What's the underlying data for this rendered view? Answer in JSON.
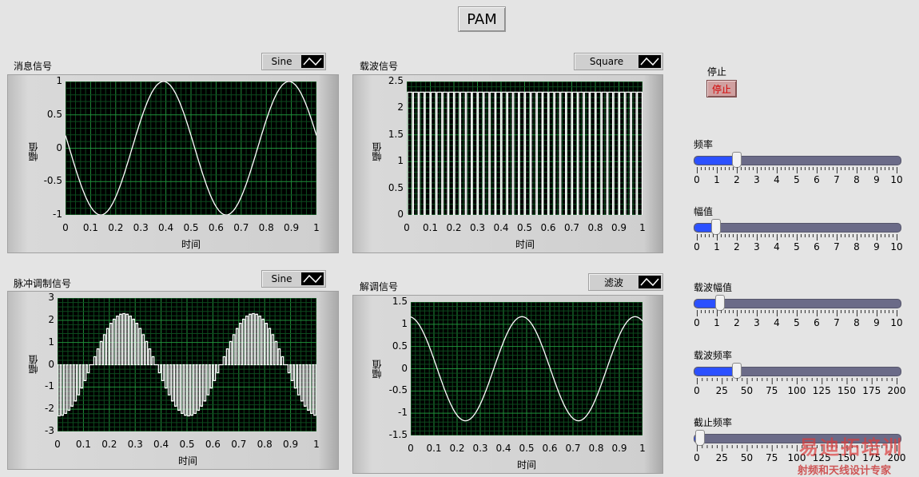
{
  "window": {
    "title_button": "PAM"
  },
  "graphs": [
    {
      "id": "msg",
      "label": "消息信号",
      "legend": "Sine",
      "ylabel": "幅值",
      "xlabel": "时间",
      "yticks": [
        "1",
        "0.5",
        "0",
        "-0.5",
        "-1"
      ],
      "xticks": [
        "0",
        "0.1",
        "0.2",
        "0.3",
        "0.4",
        "0.5",
        "0.6",
        "0.7",
        "0.8",
        "0.9",
        "1"
      ]
    },
    {
      "id": "carrier",
      "label": "载波信号",
      "legend": "Square",
      "ylabel": "幅值",
      "xlabel": "时间",
      "yticks": [
        "2.5",
        "2",
        "1.5",
        "1",
        "0.5",
        "0"
      ],
      "xticks": [
        "0",
        "0.1",
        "0.2",
        "0.3",
        "0.4",
        "0.5",
        "0.6",
        "0.7",
        "0.8",
        "0.9",
        "1"
      ]
    },
    {
      "id": "pam",
      "label": "脉冲调制信号",
      "legend": "Sine",
      "ylabel": "幅值",
      "xlabel": "时间",
      "yticks": [
        "3",
        "2",
        "1",
        "0",
        "-1",
        "-2",
        "-3"
      ],
      "xticks": [
        "0",
        "0.1",
        "0.2",
        "0.3",
        "0.4",
        "0.5",
        "0.6",
        "0.7",
        "0.8",
        "0.9",
        "1"
      ]
    },
    {
      "id": "demod",
      "label": "解调信号",
      "legend": "滤波",
      "ylabel": "幅值",
      "xlabel": "时间",
      "yticks": [
        "1.5",
        "1",
        "0.5",
        "0",
        "-0.5",
        "-1",
        "-1.5"
      ],
      "xticks": [
        "0",
        "0.1",
        "0.2",
        "0.3",
        "0.4",
        "0.5",
        "0.6",
        "0.7",
        "0.8",
        "0.9",
        "1"
      ]
    }
  ],
  "stop": {
    "label": "停止",
    "button": "停止"
  },
  "sliders": [
    {
      "label": "频率",
      "value": 2,
      "max": 10,
      "scale": [
        "0",
        "1",
        "2",
        "3",
        "4",
        "5",
        "6",
        "7",
        "8",
        "9",
        "10"
      ]
    },
    {
      "label": "幅值",
      "value": 1,
      "max": 10,
      "scale": [
        "0",
        "1",
        "2",
        "3",
        "4",
        "5",
        "6",
        "7",
        "8",
        "9",
        "10"
      ]
    },
    {
      "label": "载波幅值",
      "value": 1.2,
      "max": 10,
      "scale": [
        "0",
        "1",
        "2",
        "3",
        "4",
        "5",
        "6",
        "7",
        "8",
        "9",
        "10"
      ]
    },
    {
      "label": "载波频率",
      "value": 40,
      "max": 200,
      "scale": [
        "0",
        "25",
        "50",
        "75",
        "100",
        "125",
        "150",
        "175",
        "200"
      ]
    },
    {
      "label": "截止频率",
      "value": 5,
      "max": 200,
      "scale": [
        "0",
        "25",
        "50",
        "75",
        "100",
        "125",
        "150",
        "175",
        "200"
      ]
    }
  ],
  "watermark": {
    "line1": "易迪拓培训",
    "line2": "射频和天线设计专家"
  },
  "colors": {
    "plot_bg": "#000000",
    "grid_major": "#1f8f3a",
    "grid_minor": "#0d4a1e",
    "trace": "#ffffff",
    "slider_fill": "#2b50ff",
    "slider_track": "#6b6b88",
    "stop_text": "#d40000"
  }
}
